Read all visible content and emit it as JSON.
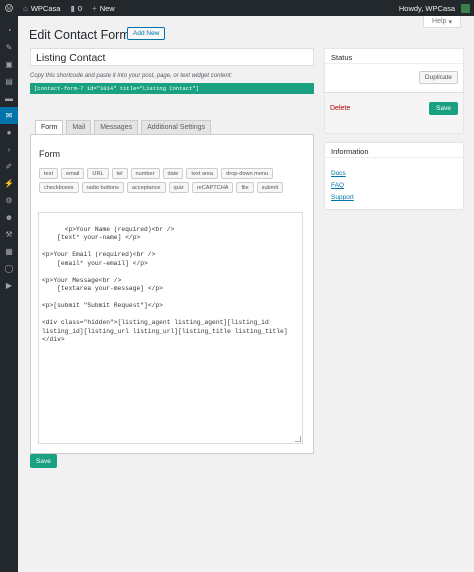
{
  "adminbar": {
    "site_name": "WPCasa",
    "comments_count": "0",
    "new_label": "New",
    "greeting": "Howdy, WPCasa"
  },
  "help_tab": "Help",
  "page": {
    "title": "Edit Contact Form",
    "add_new": "Add New",
    "form_title_value": "Listing Contact",
    "shortcode_label": "Copy this shortcode and paste it into your post, page, or text widget content:",
    "shortcode": "[contact-form-7 id=\"1014\" title=\"Listing Contact\"]"
  },
  "tabs": [
    {
      "label": "Form"
    },
    {
      "label": "Mail"
    },
    {
      "label": "Messages"
    },
    {
      "label": "Additional Settings"
    }
  ],
  "form_panel": {
    "heading": "Form",
    "tags_row1": [
      "text",
      "email",
      "URL",
      "tel",
      "number",
      "date",
      "text area",
      "drop-down menu"
    ],
    "tags_row2": [
      "checkboxes",
      "radio buttons",
      "acceptance",
      "quiz",
      "reCAPTCHA",
      "file",
      "submit"
    ],
    "editor_content": "<p>Your Name (required)<br />\n    [text* your-name] </p>\n\n<p>Your Email (required)<br />\n    [email* your-email] </p>\n\n<p>Your Message<br />\n    [textarea your-message] </p>\n\n<p>[submit \"Submit Request\"]</p>\n\n<div class=\"hidden\">[listing_agent listing_agent][listing_id listing_id][listing_url listing_url][listing_title listing_title]</div>"
  },
  "save_bottom": "Save",
  "status_box": {
    "heading": "Status",
    "duplicate": "Duplicate",
    "delete": "Delete",
    "save": "Save"
  },
  "info_box": {
    "heading": "Information",
    "links": [
      "Docs",
      "FAQ",
      "Support"
    ]
  },
  "colors": {
    "accent_green": "#1aa181",
    "admin_dark": "#23282d",
    "link_blue": "#0073aa",
    "delete_red": "#aa0000"
  },
  "icons": {
    "sidebar": [
      "dashboard-icon",
      "pin-icon",
      "media-icon",
      "pages-icon",
      "comments-icon",
      "mail-icon",
      "location-icon",
      "arrow-icon",
      "appearance-icon",
      "plugins-icon",
      "users-icon",
      "tools-icon",
      "settings-icon",
      "circle-icon",
      "play-icon"
    ]
  }
}
